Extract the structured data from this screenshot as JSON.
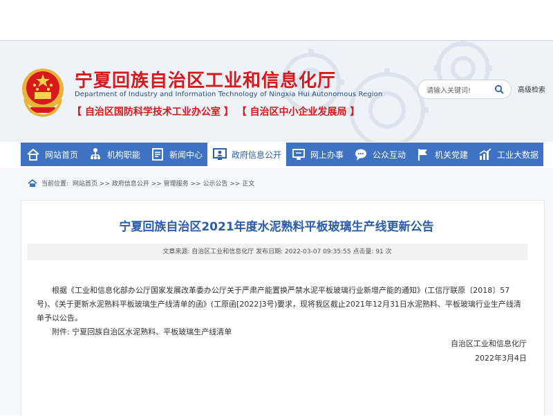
{
  "header": {
    "title": "宁夏回族自治区工业和信息化厅",
    "subtitle": "Department of Industry and Information Technology of Ningxia Hui Autonomous Region",
    "offices": "【 自治区国防科学技术工业办公室 】 【 自治区中小企业发展局 】",
    "search": {
      "placeholder": "请输入关键词!"
    },
    "advanced_search": "高级检索"
  },
  "nav": {
    "items": [
      {
        "label": "网站首页",
        "icon": "home-icon"
      },
      {
        "label": "机构职能",
        "icon": "org-chart-icon"
      },
      {
        "label": "新闻中心",
        "icon": "news-icon"
      },
      {
        "label": "政府信息公开",
        "icon": "monitor-user-icon",
        "active": true
      },
      {
        "label": "网上办事",
        "icon": "online-service-icon"
      },
      {
        "label": "公众互动",
        "icon": "chat-icon"
      },
      {
        "label": "机关党建",
        "icon": "flag-icon"
      },
      {
        "label": "工业大数据",
        "icon": "chart-icon"
      }
    ]
  },
  "breadcrumb": {
    "prefix": "当前位置:",
    "path": "网站首页 >> 政府信息公开 >> 管理服务 >> 公示公告 >> 正文"
  },
  "article": {
    "title": "宁夏回族自治区2021年度水泥熟料平板玻璃生产线更新公告",
    "meta": "文章来源: 自治区工业和信息化厅   发布日期: 2022-03-07 09:35:55   点击量: 91 次",
    "paragraph": "根据《工业和信息化部办公厅国家发展改革委办公厅关于严肃产能置换严禁水泥平板玻璃行业新增产能的通知》(工信厅联原〔2018〕57号)、《关于更新水泥熟料平板玻璃生产线清单的函》(工原函[2022]3号)要求，现将我区截止2021年12月31日水泥熟料、平板玻璃行业生产线清单予以公告。",
    "attachment": "附件: 宁夏回族自治区水泥熟料、平板玻璃生产线清单",
    "signature": "自治区工业和信息化厅",
    "date": "2022年3月4日"
  },
  "colors": {
    "title_red": "#d7191c",
    "nav_blue": "#3e73c4",
    "article_blue": "#2b5daa"
  }
}
